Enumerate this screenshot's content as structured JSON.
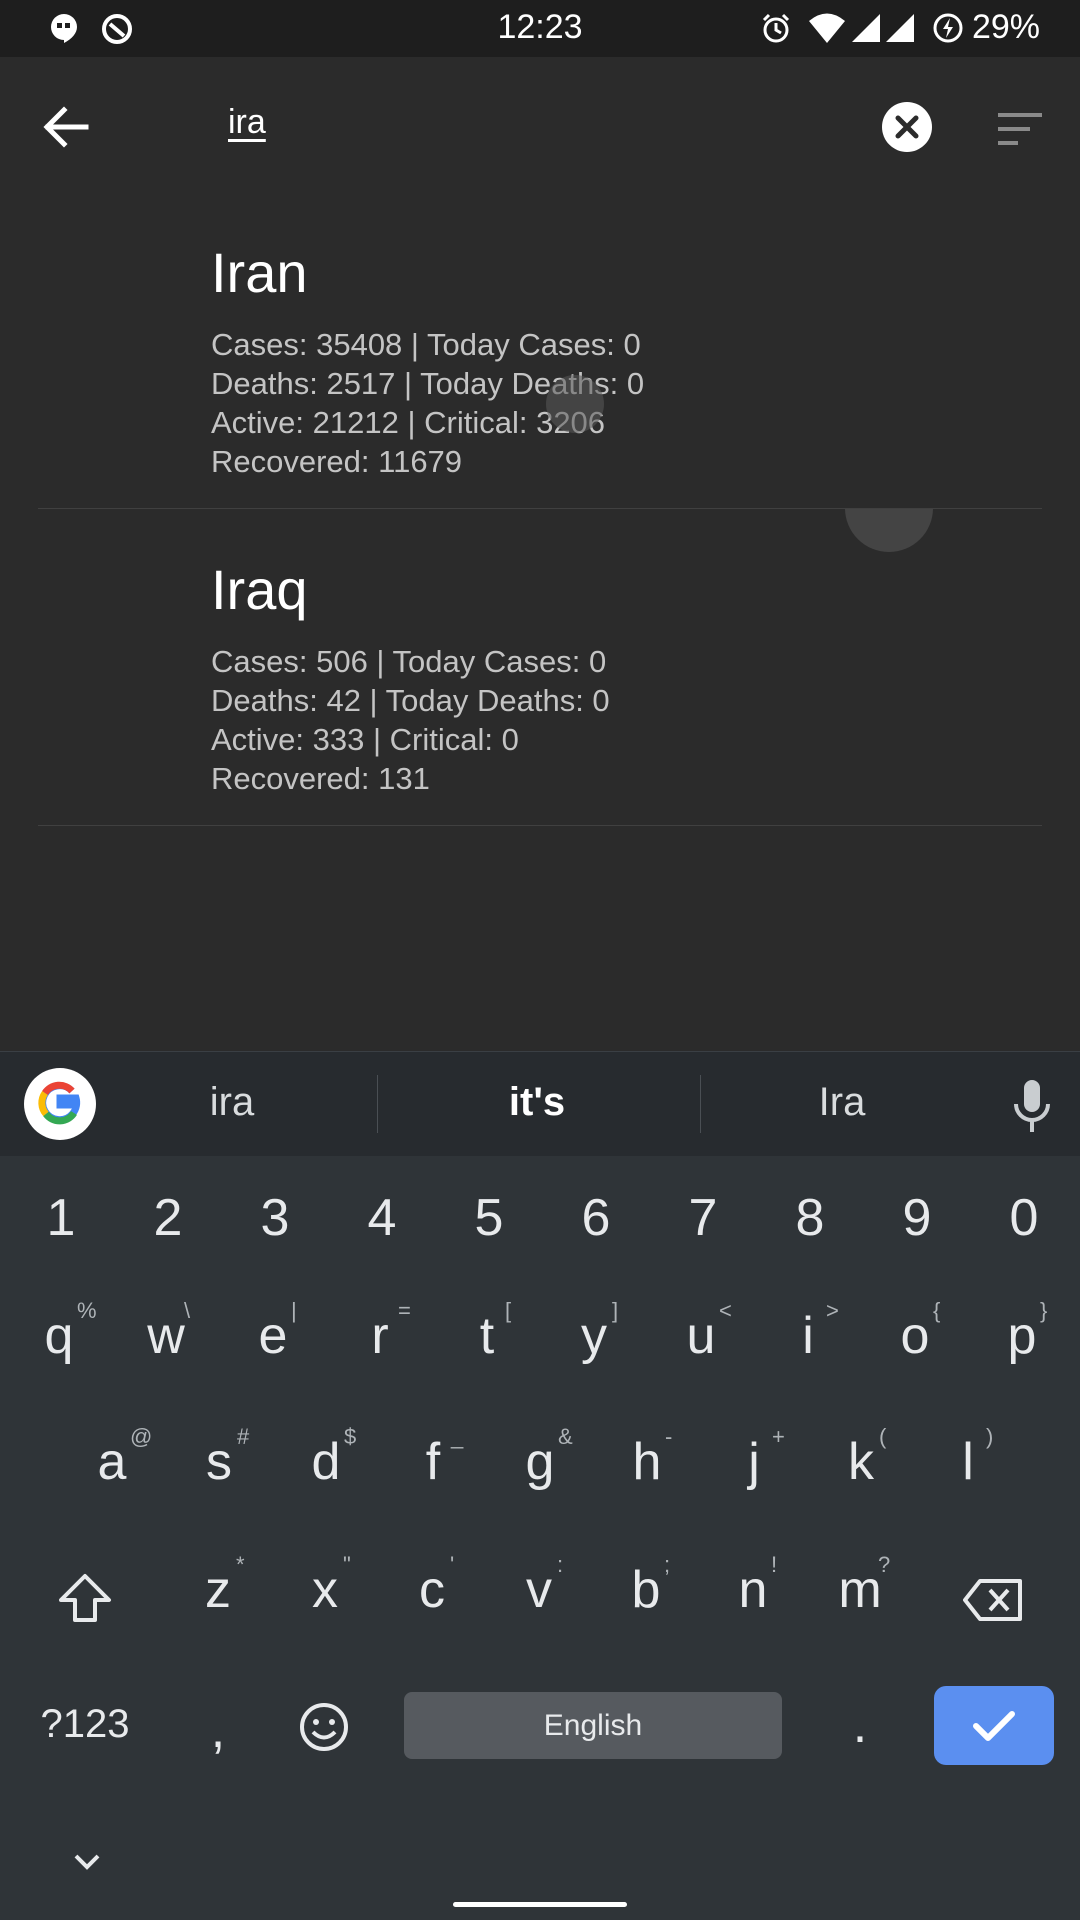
{
  "status_bar": {
    "time": "12:23",
    "battery": "29%"
  },
  "toolbar": {
    "search_query": "ira"
  },
  "results": [
    {
      "name": "Iran",
      "line1": "Cases: 35408 | Today Cases: 0",
      "line2": "Deaths: 2517 | Today Deaths: 0",
      "line3": "Active: 21212 | Critical: 3206",
      "line4": "Recovered: 11679"
    },
    {
      "name": "Iraq",
      "line1": "Cases: 506 | Today Cases: 0",
      "line2": "Deaths: 42 | Today Deaths: 0",
      "line3": "Active: 333 | Critical: 0",
      "line4": "Recovered: 131"
    }
  ],
  "keyboard": {
    "suggestions": [
      "ira",
      "it's",
      "Ira"
    ],
    "numbers": [
      "1",
      "2",
      "3",
      "4",
      "5",
      "6",
      "7",
      "8",
      "9",
      "0"
    ],
    "row1": [
      "q",
      "w",
      "e",
      "r",
      "t",
      "y",
      "u",
      "i",
      "o",
      "p"
    ],
    "row1_hints": [
      "%",
      "\\",
      "|",
      "=",
      "[",
      "]",
      "<",
      ">",
      "{",
      "}"
    ],
    "row2": [
      "a",
      "s",
      "d",
      "f",
      "g",
      "h",
      "j",
      "k",
      "l"
    ],
    "row2_hints": [
      "@",
      "#",
      "$",
      "_",
      "&",
      "-",
      "+",
      "(",
      ")"
    ],
    "row3": [
      "z",
      "x",
      "c",
      "v",
      "b",
      "n",
      "m"
    ],
    "row3_hints": [
      "*",
      "\"",
      "'",
      ":",
      ";",
      "!",
      "?"
    ],
    "symbols_label": "?123",
    "comma": ",",
    "space_label": "English",
    "period": "."
  },
  "colors": {
    "background": "#2b2b2b",
    "keyboard_bg": "#2f3438",
    "enter_key": "#5b8ff0"
  }
}
